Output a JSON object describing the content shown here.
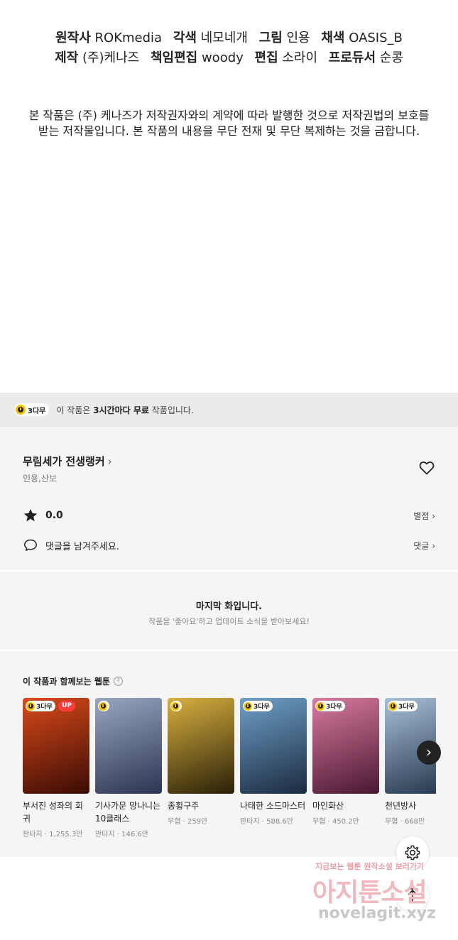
{
  "credits": {
    "line1": [
      {
        "label": "원작사",
        "value": "ROKmedia"
      },
      {
        "label": "각색",
        "value": "네모네개"
      },
      {
        "label": "그림",
        "value": "인용"
      },
      {
        "label": "채색",
        "value": "OASIS_B"
      }
    ],
    "line2": [
      {
        "label": "제작",
        "value": "(주)케나즈"
      },
      {
        "label": "책임편집",
        "value": "woody"
      },
      {
        "label": "편집",
        "value": "소라이"
      },
      {
        "label": "프로듀서",
        "value": "순콩"
      }
    ]
  },
  "notice": {
    "line1": "본 작품은 (주) 케나즈가 저작권자와의 계약에 따라 발행한 것으로 저작권법의 보호를",
    "line2": "받는 저작물입니다. 본 작품의 내용을 무단 전재 및 무단 복제하는 것을 금합니다."
  },
  "free_bar": {
    "badge": "3다무",
    "text_pre": "이 작품은 ",
    "text_bold": "3시간마다 무료",
    "text_post": " 작품입니다."
  },
  "series": {
    "title": "무림세가 전생랭커",
    "authors": "인용,산보",
    "rating": "0.0",
    "rating_link": "별점",
    "comment_placeholder": "댓글을 남겨주세요.",
    "comment_link": "댓글"
  },
  "last_episode": {
    "title": "마지막 화입니다.",
    "subtitle": "작품을 '좋아요'하고 업데이트 소식을 받아보세요!"
  },
  "recommend": {
    "title": "이 작품과 함께보는 웹툰",
    "help": "?",
    "items": [
      {
        "title": "부서진 성좌의 회귀",
        "genre": "판타지",
        "views": "1,255.3만",
        "badge": "3다무",
        "up": "UP",
        "color1": "#3a0c05",
        "color2": "#d94a1a"
      },
      {
        "title": "기사가문 망나니는 10클래스",
        "genre": "판타지",
        "views": "146.6만",
        "badge": "",
        "up": "",
        "color1": "#2b3550",
        "color2": "#9aa6c0"
      },
      {
        "title": "종횡구주",
        "genre": "무협",
        "views": "259만",
        "badge": "",
        "up": "",
        "color1": "#2a2008",
        "color2": "#d8b040"
      },
      {
        "title": "나태한 소드마스터",
        "genre": "판타지",
        "views": "588.6만",
        "badge": "3다무",
        "up": "",
        "color1": "#1c2b40",
        "color2": "#6ea0c8"
      },
      {
        "title": "마인화산",
        "genre": "무협",
        "views": "450.2만",
        "badge": "3다무",
        "up": "",
        "color1": "#4a1830",
        "color2": "#d87aa0"
      },
      {
        "title": "천년방사",
        "genre": "무협",
        "views": "668만",
        "badge": "3다무",
        "up": "",
        "color1": "#23344a",
        "color2": "#a8c0d8"
      }
    ]
  },
  "watermark": {
    "line1": "지금보는 웹툰 원작소설 보러가기",
    "line2": "아지툰소설",
    "line3": "novelagit.xyz"
  }
}
